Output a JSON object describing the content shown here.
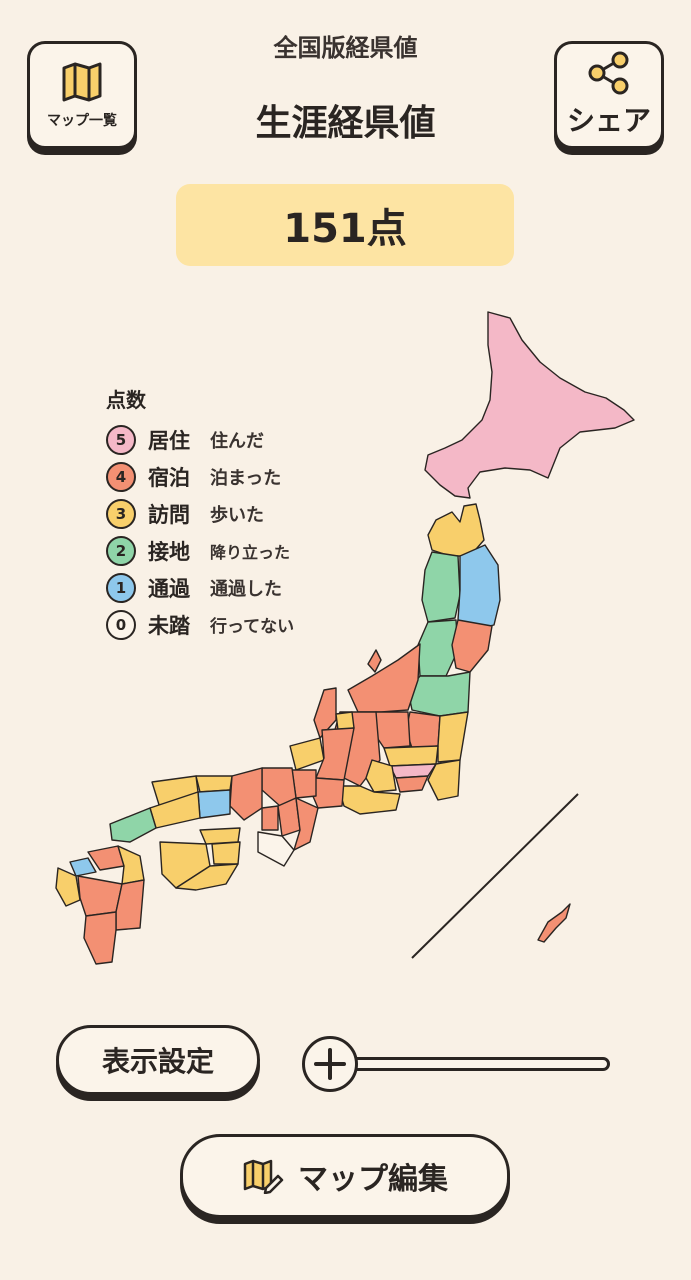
{
  "header": {
    "subtitle": "全国版経県値",
    "title": "生涯経県値",
    "maplist_label": "マップ一覧",
    "share_label": "シェア"
  },
  "score": {
    "text": "151点"
  },
  "legend": {
    "title": "点数",
    "items": [
      {
        "num": "5",
        "name": "居住",
        "desc": "住んだ",
        "color": "#f4b8c7"
      },
      {
        "num": "4",
        "name": "宿泊",
        "desc": "泊まった",
        "color": "#f39073"
      },
      {
        "num": "3",
        "name": "訪問",
        "desc": "歩いた",
        "color": "#f8cf6b"
      },
      {
        "num": "2",
        "name": "接地",
        "desc": "降り立った",
        "color": "#8fd5a8"
      },
      {
        "num": "1",
        "name": "通過",
        "desc": "通過した",
        "color": "#8ec8ec"
      },
      {
        "num": "0",
        "name": "未踏",
        "desc": "行ってない",
        "color": "#fbf4ea"
      }
    ]
  },
  "controls": {
    "display_settings": "表示設定",
    "zoom_icon": "plus-icon",
    "zoom_level": 0,
    "map_edit": "マップ編集"
  },
  "colors": {
    "background": "#f9f1e6",
    "score_bg": "#fde4a3",
    "ink": "#2a2522"
  }
}
